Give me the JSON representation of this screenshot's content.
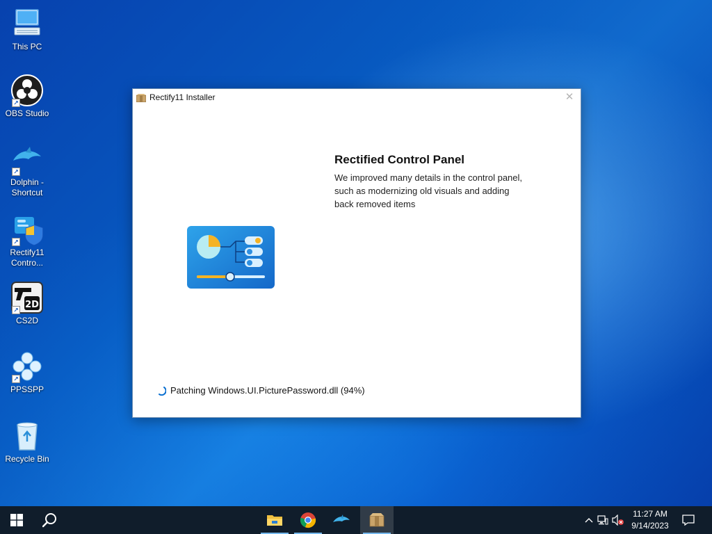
{
  "desktop": {
    "icons": [
      {
        "label": "This PC"
      },
      {
        "label": "OBS Studio"
      },
      {
        "label": "Dolphin - Shortcut"
      },
      {
        "label": "Rectify11 Contro..."
      },
      {
        "label": "CS2D"
      },
      {
        "label": "PPSSPP"
      },
      {
        "label": "Recycle Bin"
      }
    ]
  },
  "window": {
    "title": "Rectify11 Installer",
    "close_glyph": "✕",
    "feature_title": "Rectified Control Panel",
    "feature_description": "We improved many details in the control panel, such as modernizing old visuals and adding back removed items",
    "status": "Patching Windows.UI.PicturePassword.dll (94%)",
    "progress_percent": 94
  },
  "taskbar": {
    "time": "11:27 AM",
    "date": "9/14/2023",
    "pinned": [
      "start-icon",
      "search-icon",
      "file-explorer-icon",
      "chrome-icon",
      "dolphin-icon",
      "installer-icon"
    ]
  },
  "colors": {
    "accent": "#76b9ed",
    "taskbar": "#101d2b",
    "panel_blue": "#1e90e0"
  }
}
